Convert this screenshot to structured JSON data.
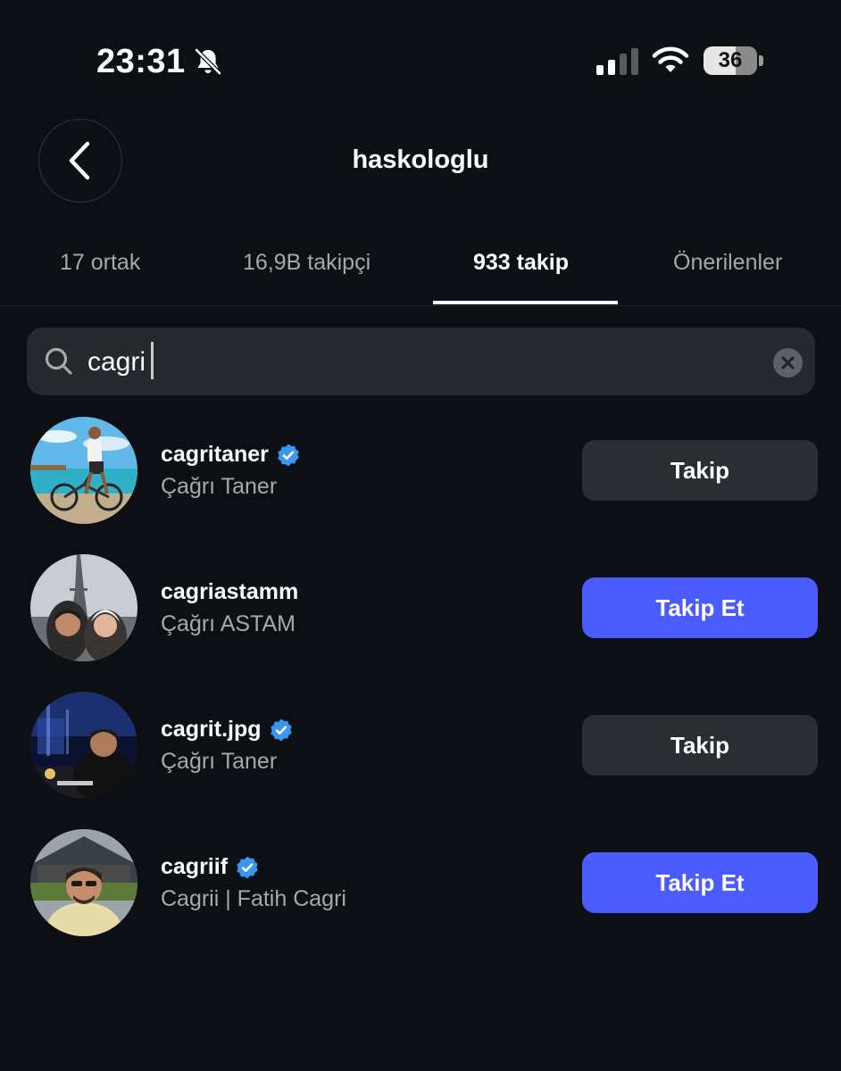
{
  "status_bar": {
    "time": "23:31",
    "battery": "36",
    "icons": [
      "bell-slash-icon",
      "signal-icon",
      "wifi-icon",
      "battery-icon"
    ]
  },
  "header": {
    "title": "haskologlu",
    "back_icon": "chevron-left-icon"
  },
  "tabs": [
    {
      "label": "17 ortak",
      "active": false
    },
    {
      "label": "16,9B takipçi",
      "active": false
    },
    {
      "label": "933 takip",
      "active": true
    },
    {
      "label": "Önerilenler",
      "active": false
    }
  ],
  "search": {
    "value": "cagri",
    "icons": [
      "search-icon",
      "clear-icon"
    ]
  },
  "results": [
    {
      "username": "cagritaner",
      "full_name": "Çağrı Taner",
      "verified": true,
      "button": "Takip",
      "button_style": "following"
    },
    {
      "username": "cagriastamm",
      "full_name": "Çağrı ASTAM",
      "verified": false,
      "button": "Takip Et",
      "button_style": "follow"
    },
    {
      "username": "cagrit.jpg",
      "full_name": "Çağrı Taner",
      "verified": true,
      "button": "Takip",
      "button_style": "following"
    },
    {
      "username": "cagriif",
      "full_name": "Cagrii | Fatih Cagri",
      "verified": true,
      "button": "Takip Et",
      "button_style": "follow"
    }
  ],
  "colors": {
    "background": "#0c1014",
    "follow_button": "#4a5cff",
    "following_button": "#2a2e33",
    "verified": "#3897f0"
  }
}
